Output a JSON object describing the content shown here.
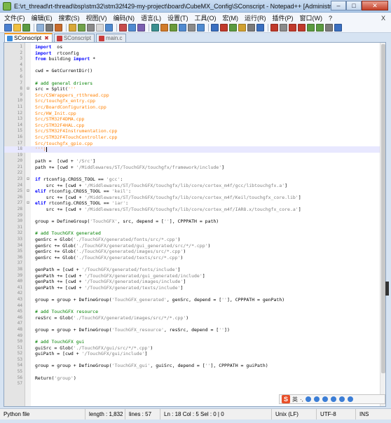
{
  "window": {
    "title": "E:\\rt_thread\\rt-thread\\bsp\\stm32\\stm32f429-my-project\\board\\CubeMX_Config\\SConscript - Notepad++ [Administrator]",
    "minimize": "–",
    "maximize": "□",
    "close": "✕"
  },
  "menu": {
    "items": [
      "文件(F)",
      "编辑(E)",
      "搜索(S)",
      "视图(V)",
      "编码(N)",
      "语言(L)",
      "设置(T)",
      "工具(O)",
      "宏(M)",
      "运行(R)",
      "插件(P)",
      "窗口(W)",
      "?"
    ],
    "close": "X"
  },
  "toolbar": {
    "colors": [
      "#4a7fd0",
      "#f0c040",
      "#5a9a40",
      "#8fb1d9",
      "#7a7a7a",
      "#c96b2b",
      "#d8a838",
      "#6fa14a",
      "#8a8a8a",
      "#d8d8d8",
      "#4f8ad0",
      "#c64c4c",
      "#4f8ad0",
      "#7a5fb0",
      "#3a8f8f",
      "#d07a2a",
      "#6a9a3a",
      "#4f8ad0",
      "#8a8a8a",
      "#4f8ad0",
      "#3a6fc0",
      "#c0392b",
      "#5a9a40",
      "#d0a030",
      "#7a7a7a",
      "#3a6fc0",
      "#c0392b",
      "#8a8a8a",
      "#c0392b",
      "#c0392b",
      "#5a9a40",
      "#5a9a40",
      "#7a7a7a",
      "#3a6fc0"
    ]
  },
  "tabs": [
    {
      "label": "SConscript",
      "active": true
    },
    {
      "label": "SConscript",
      "active": false
    },
    {
      "label": "main.c",
      "active": false
    }
  ],
  "editor": {
    "current_line": 18,
    "lines": [
      {
        "n": "1",
        "f": "",
        "t": [
          [
            "kw",
            "import"
          ],
          [
            "",
            "  os"
          ]
        ]
      },
      {
        "n": "2",
        "f": "",
        "t": [
          [
            "kw",
            "import"
          ],
          [
            "",
            "  rtconfig"
          ]
        ]
      },
      {
        "n": "3",
        "f": "",
        "t": [
          [
            "kw",
            "from"
          ],
          [
            "",
            " building "
          ],
          [
            "kw",
            "import"
          ],
          [
            "",
            " *"
          ]
        ]
      },
      {
        "n": "4",
        "f": "",
        "t": []
      },
      {
        "n": "5",
        "f": "",
        "t": [
          [
            "",
            "cwd = GetCurrentDir()"
          ]
        ]
      },
      {
        "n": "6",
        "f": "",
        "t": []
      },
      {
        "n": "7",
        "f": "",
        "t": [
          [
            "cm",
            "# add general drivers"
          ]
        ]
      },
      {
        "n": "8",
        "f": "⊟",
        "t": [
          [
            "",
            "src = Split("
          ],
          [
            "or",
            "'''"
          ]
        ]
      },
      {
        "n": "9",
        "f": "",
        "t": [
          [
            "or",
            "Src/CSWrappers_rtthread.cpp"
          ]
        ]
      },
      {
        "n": "10",
        "f": "",
        "t": [
          [
            "or",
            "Src/touchgfx_entry.cpp"
          ]
        ]
      },
      {
        "n": "11",
        "f": "",
        "t": [
          [
            "or",
            "Src/BoardConfiguration.cpp"
          ]
        ]
      },
      {
        "n": "12",
        "f": "",
        "t": [
          [
            "or",
            "Src/HW_Init.cpp"
          ]
        ]
      },
      {
        "n": "13",
        "f": "",
        "t": [
          [
            "or",
            "Src/STM32F4DMA.cpp"
          ]
        ]
      },
      {
        "n": "14",
        "f": "",
        "t": [
          [
            "or",
            "Src/STM32F4HAL.cpp"
          ]
        ]
      },
      {
        "n": "15",
        "f": "",
        "t": [
          [
            "or",
            "Src/STM32F4Instrumentation.cpp"
          ]
        ]
      },
      {
        "n": "16",
        "f": "",
        "t": [
          [
            "or",
            "Src/STM32F4TouchController.cpp"
          ]
        ]
      },
      {
        "n": "17",
        "f": "",
        "t": [
          [
            "or",
            "Src/touchgfx_gpio.cpp"
          ]
        ]
      },
      {
        "n": "18",
        "f": "",
        "t": [
          [
            "or",
            "''')"
          ]
        ]
      },
      {
        "n": "19",
        "f": "",
        "t": []
      },
      {
        "n": "20",
        "f": "",
        "t": [
          [
            "",
            "path =  [cwd + "
          ],
          [
            "st",
            "'/Src'"
          ],
          [
            "",
            "]"
          ]
        ]
      },
      {
        "n": "21",
        "f": "",
        "t": [
          [
            "",
            "path += [cwd + "
          ],
          [
            "st",
            "'/Middlewares/ST/TouchGFX/touchgfx/framework/include'"
          ],
          [
            "",
            "]"
          ]
        ]
      },
      {
        "n": "22",
        "f": "",
        "t": []
      },
      {
        "n": "23",
        "f": "⊟",
        "t": [
          [
            "kw",
            "if"
          ],
          [
            "",
            " rtconfig.CROSS_TOOL == "
          ],
          [
            "st",
            "'gcc'"
          ],
          [
            "",
            ":"
          ]
        ]
      },
      {
        "n": "24",
        "f": "",
        "t": [
          [
            "",
            "    src += [cwd + "
          ],
          [
            "st",
            "'/Middlewares/ST/TouchGFX/touchgfx/lib/core/cortex_m4f/gcc/libtouchgfx.a'"
          ],
          [
            "",
            "]"
          ]
        ]
      },
      {
        "n": "25",
        "f": "⊟",
        "t": [
          [
            "kw",
            "elif"
          ],
          [
            "",
            " rtconfig.CROSS_TOOL == "
          ],
          [
            "st",
            "'keil'"
          ],
          [
            "",
            ":"
          ]
        ]
      },
      {
        "n": "26",
        "f": "",
        "t": [
          [
            "",
            "    src += [cwd + "
          ],
          [
            "st",
            "'/Middlewares/ST/TouchGFX/touchgfx/lib/core/cortex_m4f/Keil/touchgfx_core.lib'"
          ],
          [
            "",
            "]"
          ]
        ]
      },
      {
        "n": "27",
        "f": "⊟",
        "t": [
          [
            "kw",
            "elif"
          ],
          [
            "",
            " rtconfig.CROSS_TOOL == "
          ],
          [
            "st",
            "'iar'"
          ],
          [
            "",
            ":"
          ]
        ]
      },
      {
        "n": "28",
        "f": "",
        "t": [
          [
            "",
            "    src += [cwd + "
          ],
          [
            "st",
            "'/Middlewares/ST/TouchGFX/touchgfx/lib/core/cortex_m4f/IAR8.x/touchgfx_core.a'"
          ],
          [
            "",
            "]"
          ]
        ]
      },
      {
        "n": "29",
        "f": "",
        "t": []
      },
      {
        "n": "30",
        "f": "",
        "t": [
          [
            "",
            "group = DefineGroup("
          ],
          [
            "st",
            "'TouchGFX'"
          ],
          [
            "",
            ", src, depend = ["
          ],
          [
            "st",
            "''"
          ],
          [
            "",
            "], CPPPATH = path)"
          ]
        ]
      },
      {
        "n": "31",
        "f": "",
        "t": []
      },
      {
        "n": "32",
        "f": "",
        "t": [
          [
            "cm",
            "# add TouchGFX generated"
          ]
        ]
      },
      {
        "n": "33",
        "f": "",
        "t": [
          [
            "",
            "genSrc = Glob("
          ],
          [
            "st",
            "'./TouchGFX/generated/fonts/src/*.cpp'"
          ],
          [
            "",
            ")"
          ]
        ]
      },
      {
        "n": "34",
        "f": "",
        "t": [
          [
            "",
            "genSrc += Glob("
          ],
          [
            "st",
            "'./TouchGFX/generated/gui_generated/src/*/*.cpp'"
          ],
          [
            "",
            ")"
          ]
        ]
      },
      {
        "n": "35",
        "f": "",
        "t": [
          [
            "",
            "genSrc += Glob("
          ],
          [
            "st",
            "'./TouchGFX/generated/images/src/*.cpp'"
          ],
          [
            "",
            ")"
          ]
        ]
      },
      {
        "n": "36",
        "f": "",
        "t": [
          [
            "",
            "genSrc += Glob("
          ],
          [
            "st",
            "'./TouchGFX/generated/texts/src/*.cpp'"
          ],
          [
            "",
            ")"
          ]
        ]
      },
      {
        "n": "37",
        "f": "",
        "t": []
      },
      {
        "n": "38",
        "f": "",
        "t": [
          [
            "",
            "genPath = [cwd + "
          ],
          [
            "st",
            "'/TouchGFX/generated/fonts/include'"
          ],
          [
            "",
            "]"
          ]
        ]
      },
      {
        "n": "39",
        "f": "",
        "t": [
          [
            "",
            "genPath += [cwd + "
          ],
          [
            "st",
            "'/TouchGFX/generated/gui_generated/include'"
          ],
          [
            "",
            "]"
          ]
        ]
      },
      {
        "n": "40",
        "f": "",
        "t": [
          [
            "",
            "genPath += [cwd + "
          ],
          [
            "st",
            "'/TouchGFX/generated/images/include'"
          ],
          [
            "",
            "]"
          ]
        ]
      },
      {
        "n": "41",
        "f": "",
        "t": [
          [
            "",
            "genPath += [cwd + "
          ],
          [
            "st",
            "'/TouchGFX/generated/texts/include'"
          ],
          [
            "",
            "]"
          ]
        ]
      },
      {
        "n": "42",
        "f": "",
        "t": []
      },
      {
        "n": "43",
        "f": "",
        "t": [
          [
            "",
            "group = group + DefineGroup("
          ],
          [
            "st",
            "'TouchGFX_generated'"
          ],
          [
            "",
            ", genSrc, depend = ["
          ],
          [
            "st",
            "''"
          ],
          [
            "",
            "], CPPPATH = genPath)"
          ]
        ]
      },
      {
        "n": "44",
        "f": "",
        "t": []
      },
      {
        "n": "45",
        "f": "",
        "t": [
          [
            "cm",
            "# add TouchGFX resource"
          ]
        ]
      },
      {
        "n": "46",
        "f": "",
        "t": [
          [
            "",
            "resSrc = Glob("
          ],
          [
            "st",
            "'./TouchGFX/generated/images/src/*/*.cpp'"
          ],
          [
            "",
            ")"
          ]
        ]
      },
      {
        "n": "47",
        "f": "",
        "t": []
      },
      {
        "n": "48",
        "f": "",
        "t": [
          [
            "",
            "group = group + DefineGroup("
          ],
          [
            "st",
            "'TouchGFX_resource'"
          ],
          [
            "",
            ", resSrc, depend = ["
          ],
          [
            "st",
            "''"
          ],
          [
            "",
            "])"
          ]
        ]
      },
      {
        "n": "49",
        "f": "",
        "t": []
      },
      {
        "n": "50",
        "f": "",
        "t": [
          [
            "cm",
            "# add TouchGFX gui"
          ]
        ]
      },
      {
        "n": "51",
        "f": "",
        "t": [
          [
            "",
            "guiSrc = Glob("
          ],
          [
            "st",
            "'./TouchGFX/gui/src/*/*.cpp'"
          ],
          [
            "",
            ")"
          ]
        ]
      },
      {
        "n": "52",
        "f": "",
        "t": [
          [
            "",
            "guiPath = [cwd + "
          ],
          [
            "st",
            "'/TouchGFX/gui/include'"
          ],
          [
            "",
            "]"
          ]
        ]
      },
      {
        "n": "53",
        "f": "",
        "t": []
      },
      {
        "n": "54",
        "f": "",
        "t": [
          [
            "",
            "group = group + DefineGroup("
          ],
          [
            "st",
            "'TouchGFX_gui'"
          ],
          [
            "",
            ", guiSrc, depend = ["
          ],
          [
            "st",
            "''"
          ],
          [
            "",
            "], CPPPATH = guiPath)"
          ]
        ]
      },
      {
        "n": "55",
        "f": "",
        "t": []
      },
      {
        "n": "56",
        "f": "",
        "t": [
          [
            "",
            "Return("
          ],
          [
            "st",
            "'group'"
          ],
          [
            "",
            ")"
          ]
        ]
      },
      {
        "n": "57",
        "f": "",
        "t": []
      }
    ]
  },
  "ime": {
    "logo": "S",
    "label": "英",
    "extra": "·,"
  },
  "status": {
    "file_type": "Python file",
    "length": "length : 1,832",
    "lines": "lines : 57",
    "position": "Ln : 18   Col : 5   Sel : 0 | 0",
    "eol": "Unix (LF)",
    "encoding": "UTF-8",
    "mode": "INS"
  }
}
